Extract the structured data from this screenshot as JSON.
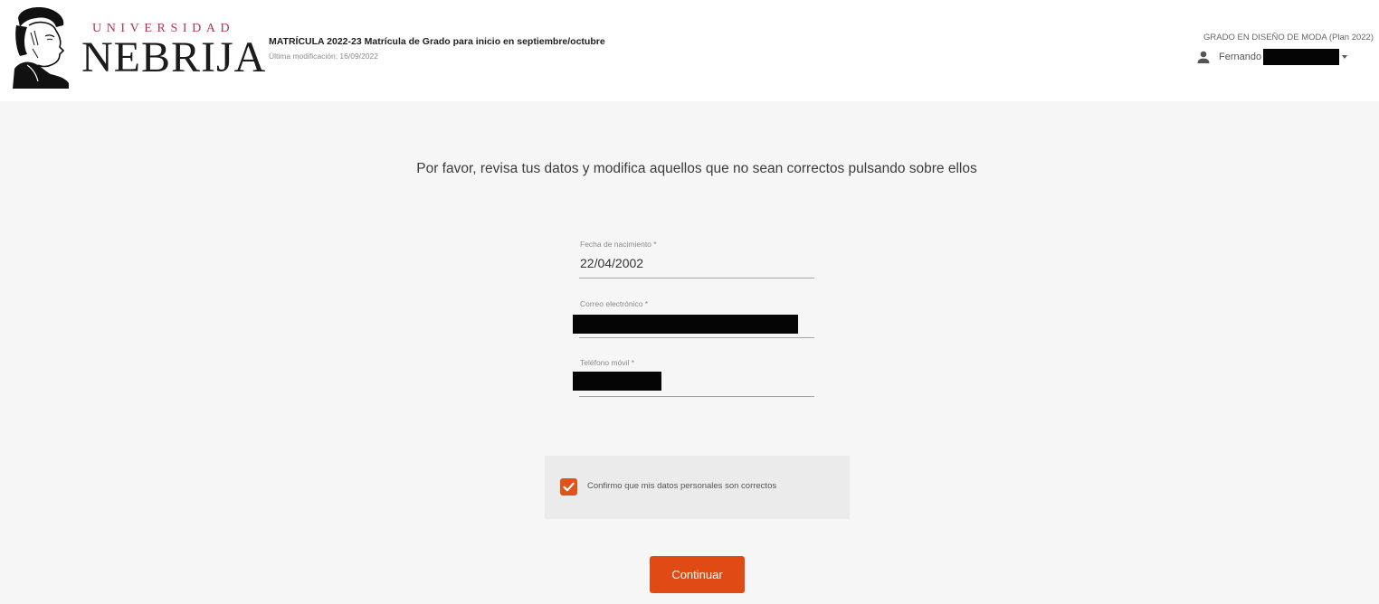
{
  "header": {
    "logo_top": "UNIVERSIDAD",
    "logo_main": "NEBRIJA",
    "title": "MATRÍCULA 2022-23 Matrícula de Grado para inicio en septiembre/octubre",
    "last_modified": "Última modificación: 16/09/2022",
    "degree": "GRADO EN DISEÑO DE MODA (Plan 2022)",
    "user_name": "Fernando",
    "user_icon": "person-icon",
    "user_menu_icon": "caret-down-icon"
  },
  "main": {
    "instructions": "Por favor, revisa tus datos y modifica aquellos que no sean correctos pulsando sobre ellos",
    "fields": [
      {
        "label": "Fecha de nacimiento *",
        "value": "22/04/2002"
      },
      {
        "label": "Correo electrónico *",
        "value": ""
      },
      {
        "label": "Teléfono móvil *",
        "value": ""
      }
    ],
    "confirm_label": "Confirmo que mis datos personales son correctos",
    "confirm_checked": true,
    "continue_label": "Continuar"
  },
  "colors": {
    "accent": "#df4a15",
    "checkbox": "#e0541c",
    "logo_red": "#b3354a",
    "background": "#f6f6f6"
  }
}
